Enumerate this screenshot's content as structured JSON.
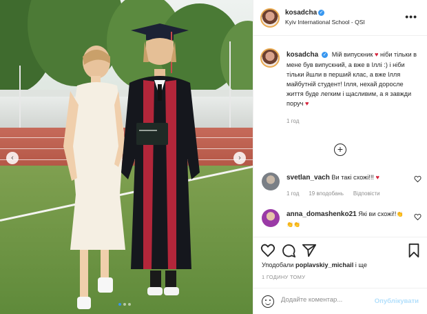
{
  "post": {
    "photo_alt": "",
    "carousel": {
      "count": 3,
      "active": 1
    }
  },
  "header": {
    "username": "kosadcha",
    "verified_glyph": "✓",
    "location": "Kyiv International School - QSI",
    "more_glyph": "•••"
  },
  "caption": {
    "username": "kosadcha",
    "text_1": "Мій випускник ",
    "heart_1": "♥",
    "text_2": " ніби тільки в мене був випускний, а вже в Іллі :) і ніби тільки йшли в перший клас, а вже Ілля майбутній студент! Ілля, нехай доросле життя буде легким і щасливим, а я завжди поруч ",
    "heart_2": "♥",
    "time": "1 год"
  },
  "load_more_glyph": "+",
  "comments": [
    {
      "username": "svetlan_vach",
      "text": "Ви такі схожі!!! ",
      "heart": "♥",
      "time": "1 год",
      "likes": "19 вподобань",
      "reply": "Відповісти",
      "avatar_color": "#7a7f86"
    },
    {
      "username": "anna_domashenko21",
      "text": "Які ви схожі!!",
      "emoji": "👏👏👏",
      "avatar_color": "#9a3aa6"
    }
  ],
  "actions": {
    "likes_prefix": "Уподобали ",
    "likes_user": "poplavskiy_michail",
    "likes_suffix": " і ще",
    "time": "1 годину тому"
  },
  "comment_input": {
    "placeholder": "Додайте коментар...",
    "post_label": "Опублікувати"
  },
  "colors": {
    "accent": "#3897f0",
    "heart": "#d6243c",
    "post_disabled": "#b2dffc"
  },
  "icons": [
    "heart-icon",
    "comment-icon",
    "share-icon",
    "bookmark-icon",
    "emoji-icon",
    "plus-circle-icon",
    "chevron-left-icon",
    "chevron-right-icon",
    "verified-icon",
    "more-icon"
  ]
}
